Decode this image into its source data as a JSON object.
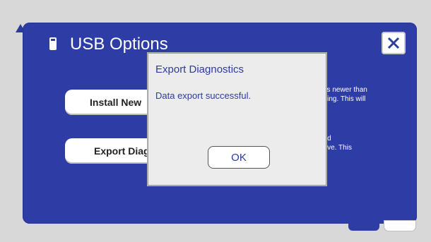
{
  "screen": {
    "title": "USB Options",
    "close_symbol": "✕",
    "buttons": {
      "install_label": "Install New",
      "export_label": "Export Diag"
    },
    "descriptions": {
      "install": "3 is newer than\nnning. This will",
      "export": "and\ndrive. This\n."
    },
    "icons": [
      "usb-drive-icon",
      "close-icon",
      "back-notch-icon"
    ]
  },
  "dialog": {
    "title": "Export Diagnostics",
    "message": "Data export successful.",
    "ok_label": "OK"
  },
  "colors": {
    "screen_blue": "#2e3ca6",
    "dialog_text": "#2d3aa0",
    "dialog_bg": "#ececec"
  }
}
